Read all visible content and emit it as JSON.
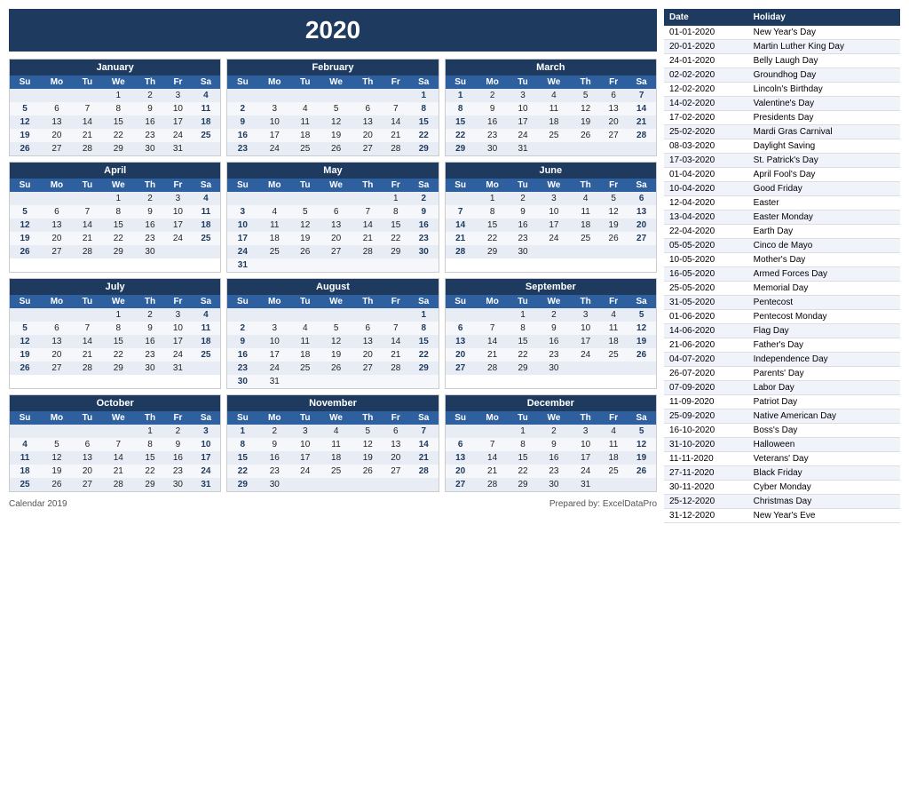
{
  "title": "2020",
  "footer": {
    "left": "Calendar 2019",
    "right": "Prepared by: ExcelDataPro"
  },
  "months": [
    {
      "name": "January",
      "days": [
        "Su",
        "Mo",
        "Tu",
        "We",
        "Th",
        "Fr",
        "Sa"
      ],
      "rows": [
        [
          "",
          "",
          "",
          "1",
          "2",
          "3",
          "4"
        ],
        [
          "5",
          "6",
          "7",
          "8",
          "9",
          "10",
          "11"
        ],
        [
          "12",
          "13",
          "14",
          "15",
          "16",
          "17",
          "18"
        ],
        [
          "19",
          "20",
          "21",
          "22",
          "23",
          "24",
          "25"
        ],
        [
          "26",
          "27",
          "28",
          "29",
          "30",
          "31",
          ""
        ]
      ]
    },
    {
      "name": "February",
      "days": [
        "Su",
        "Mo",
        "Tu",
        "We",
        "Th",
        "Fr",
        "Sa"
      ],
      "rows": [
        [
          "",
          "",
          "",
          "",
          "",
          "",
          "1"
        ],
        [
          "2",
          "3",
          "4",
          "5",
          "6",
          "7",
          "8"
        ],
        [
          "9",
          "10",
          "11",
          "12",
          "13",
          "14",
          "15"
        ],
        [
          "16",
          "17",
          "18",
          "19",
          "20",
          "21",
          "22"
        ],
        [
          "23",
          "24",
          "25",
          "26",
          "27",
          "28",
          "29"
        ]
      ]
    },
    {
      "name": "March",
      "days": [
        "Su",
        "Mo",
        "Tu",
        "We",
        "Th",
        "Fr",
        "Sa"
      ],
      "rows": [
        [
          "1",
          "2",
          "3",
          "4",
          "5",
          "6",
          "7"
        ],
        [
          "8",
          "9",
          "10",
          "11",
          "12",
          "13",
          "14"
        ],
        [
          "15",
          "16",
          "17",
          "18",
          "19",
          "20",
          "21"
        ],
        [
          "22",
          "23",
          "24",
          "25",
          "26",
          "27",
          "28"
        ],
        [
          "29",
          "30",
          "31",
          "",
          "",
          "",
          ""
        ]
      ]
    },
    {
      "name": "April",
      "days": [
        "Su",
        "Mo",
        "Tu",
        "We",
        "Th",
        "Fr",
        "Sa"
      ],
      "rows": [
        [
          "",
          "",
          "",
          "1",
          "2",
          "3",
          "4"
        ],
        [
          "5",
          "6",
          "7",
          "8",
          "9",
          "10",
          "11"
        ],
        [
          "12",
          "13",
          "14",
          "15",
          "16",
          "17",
          "18"
        ],
        [
          "19",
          "20",
          "21",
          "22",
          "23",
          "24",
          "25"
        ],
        [
          "26",
          "27",
          "28",
          "29",
          "30",
          "",
          ""
        ]
      ]
    },
    {
      "name": "May",
      "days": [
        "Su",
        "Mo",
        "Tu",
        "We",
        "Th",
        "Fr",
        "Sa"
      ],
      "rows": [
        [
          "",
          "",
          "",
          "",
          "",
          "1",
          "2"
        ],
        [
          "3",
          "4",
          "5",
          "6",
          "7",
          "8",
          "9"
        ],
        [
          "10",
          "11",
          "12",
          "13",
          "14",
          "15",
          "16"
        ],
        [
          "17",
          "18",
          "19",
          "20",
          "21",
          "22",
          "23"
        ],
        [
          "24",
          "25",
          "26",
          "27",
          "28",
          "29",
          "30"
        ],
        [
          "31",
          "",
          "",
          "",
          "",
          "",
          ""
        ]
      ]
    },
    {
      "name": "June",
      "days": [
        "Su",
        "Mo",
        "Tu",
        "We",
        "Th",
        "Fr",
        "Sa"
      ],
      "rows": [
        [
          "",
          "1",
          "2",
          "3",
          "4",
          "5",
          "6"
        ],
        [
          "7",
          "8",
          "9",
          "10",
          "11",
          "12",
          "13"
        ],
        [
          "14",
          "15",
          "16",
          "17",
          "18",
          "19",
          "20"
        ],
        [
          "21",
          "22",
          "23",
          "24",
          "25",
          "26",
          "27"
        ],
        [
          "28",
          "29",
          "30",
          "",
          "",
          "",
          ""
        ]
      ]
    },
    {
      "name": "July",
      "days": [
        "Su",
        "Mo",
        "Tu",
        "We",
        "Th",
        "Fr",
        "Sa"
      ],
      "rows": [
        [
          "",
          "",
          "",
          "1",
          "2",
          "3",
          "4"
        ],
        [
          "5",
          "6",
          "7",
          "8",
          "9",
          "10",
          "11"
        ],
        [
          "12",
          "13",
          "14",
          "15",
          "16",
          "17",
          "18"
        ],
        [
          "19",
          "20",
          "21",
          "22",
          "23",
          "24",
          "25"
        ],
        [
          "26",
          "27",
          "28",
          "29",
          "30",
          "31",
          ""
        ]
      ]
    },
    {
      "name": "August",
      "days": [
        "Su",
        "Mo",
        "Tu",
        "We",
        "Th",
        "Fr",
        "Sa"
      ],
      "rows": [
        [
          "",
          "",
          "",
          "",
          "",
          "",
          "1"
        ],
        [
          "2",
          "3",
          "4",
          "5",
          "6",
          "7",
          "8"
        ],
        [
          "9",
          "10",
          "11",
          "12",
          "13",
          "14",
          "15"
        ],
        [
          "16",
          "17",
          "18",
          "19",
          "20",
          "21",
          "22"
        ],
        [
          "23",
          "24",
          "25",
          "26",
          "27",
          "28",
          "29"
        ],
        [
          "30",
          "31",
          "",
          "",
          "",
          "",
          ""
        ]
      ]
    },
    {
      "name": "September",
      "days": [
        "Su",
        "Mo",
        "Tu",
        "We",
        "Th",
        "Fr",
        "Sa"
      ],
      "rows": [
        [
          "",
          "",
          "1",
          "2",
          "3",
          "4",
          "5"
        ],
        [
          "6",
          "7",
          "8",
          "9",
          "10",
          "11",
          "12"
        ],
        [
          "13",
          "14",
          "15",
          "16",
          "17",
          "18",
          "19"
        ],
        [
          "20",
          "21",
          "22",
          "23",
          "24",
          "25",
          "26"
        ],
        [
          "27",
          "28",
          "29",
          "30",
          "",
          "",
          ""
        ]
      ]
    },
    {
      "name": "October",
      "days": [
        "Su",
        "Mo",
        "Tu",
        "We",
        "Th",
        "Fr",
        "Sa"
      ],
      "rows": [
        [
          "",
          "",
          "",
          "",
          "1",
          "2",
          "3"
        ],
        [
          "4",
          "5",
          "6",
          "7",
          "8",
          "9",
          "10"
        ],
        [
          "11",
          "12",
          "13",
          "14",
          "15",
          "16",
          "17"
        ],
        [
          "18",
          "19",
          "20",
          "21",
          "22",
          "23",
          "24"
        ],
        [
          "25",
          "26",
          "27",
          "28",
          "29",
          "30",
          "31"
        ]
      ]
    },
    {
      "name": "November",
      "days": [
        "Su",
        "Mo",
        "Tu",
        "We",
        "Th",
        "Fr",
        "Sa"
      ],
      "rows": [
        [
          "1",
          "2",
          "3",
          "4",
          "5",
          "6",
          "7"
        ],
        [
          "8",
          "9",
          "10",
          "11",
          "12",
          "13",
          "14"
        ],
        [
          "15",
          "16",
          "17",
          "18",
          "19",
          "20",
          "21"
        ],
        [
          "22",
          "23",
          "24",
          "25",
          "26",
          "27",
          "28"
        ],
        [
          "29",
          "30",
          "",
          "",
          "",
          "",
          ""
        ]
      ]
    },
    {
      "name": "December",
      "days": [
        "Su",
        "Mo",
        "Tu",
        "We",
        "Th",
        "Fr",
        "Sa"
      ],
      "rows": [
        [
          "",
          "",
          "1",
          "2",
          "3",
          "4",
          "5"
        ],
        [
          "6",
          "7",
          "8",
          "9",
          "10",
          "11",
          "12"
        ],
        [
          "13",
          "14",
          "15",
          "16",
          "17",
          "18",
          "19"
        ],
        [
          "20",
          "21",
          "22",
          "23",
          "24",
          "25",
          "26"
        ],
        [
          "27",
          "28",
          "29",
          "30",
          "31",
          "",
          ""
        ]
      ]
    }
  ],
  "holidays": {
    "header": [
      "Date",
      "Holiday"
    ],
    "rows": [
      [
        "01-01-2020",
        "New Year's Day"
      ],
      [
        "20-01-2020",
        "Martin Luther King Day"
      ],
      [
        "24-01-2020",
        "Belly Laugh Day"
      ],
      [
        "02-02-2020",
        "Groundhog Day"
      ],
      [
        "12-02-2020",
        "Lincoln's Birthday"
      ],
      [
        "14-02-2020",
        "Valentine's Day"
      ],
      [
        "17-02-2020",
        "Presidents Day"
      ],
      [
        "25-02-2020",
        "Mardi Gras Carnival"
      ],
      [
        "08-03-2020",
        "Daylight Saving"
      ],
      [
        "17-03-2020",
        "St. Patrick's Day"
      ],
      [
        "01-04-2020",
        "April Fool's Day"
      ],
      [
        "10-04-2020",
        "Good Friday"
      ],
      [
        "12-04-2020",
        "Easter"
      ],
      [
        "13-04-2020",
        "Easter Monday"
      ],
      [
        "22-04-2020",
        "Earth Day"
      ],
      [
        "05-05-2020",
        "Cinco de Mayo"
      ],
      [
        "10-05-2020",
        "Mother's Day"
      ],
      [
        "16-05-2020",
        "Armed Forces Day"
      ],
      [
        "25-05-2020",
        "Memorial Day"
      ],
      [
        "31-05-2020",
        "Pentecost"
      ],
      [
        "01-06-2020",
        "Pentecost Monday"
      ],
      [
        "14-06-2020",
        "Flag Day"
      ],
      [
        "21-06-2020",
        "Father's Day"
      ],
      [
        "04-07-2020",
        "Independence Day"
      ],
      [
        "26-07-2020",
        "Parents' Day"
      ],
      [
        "07-09-2020",
        "Labor Day"
      ],
      [
        "11-09-2020",
        "Patriot Day"
      ],
      [
        "25-09-2020",
        "Native American Day"
      ],
      [
        "16-10-2020",
        "Boss's Day"
      ],
      [
        "31-10-2020",
        "Halloween"
      ],
      [
        "11-11-2020",
        "Veterans' Day"
      ],
      [
        "27-11-2020",
        "Black Friday"
      ],
      [
        "30-11-2020",
        "Cyber Monday"
      ],
      [
        "25-12-2020",
        "Christmas Day"
      ],
      [
        "31-12-2020",
        "New Year's Eve"
      ]
    ]
  }
}
